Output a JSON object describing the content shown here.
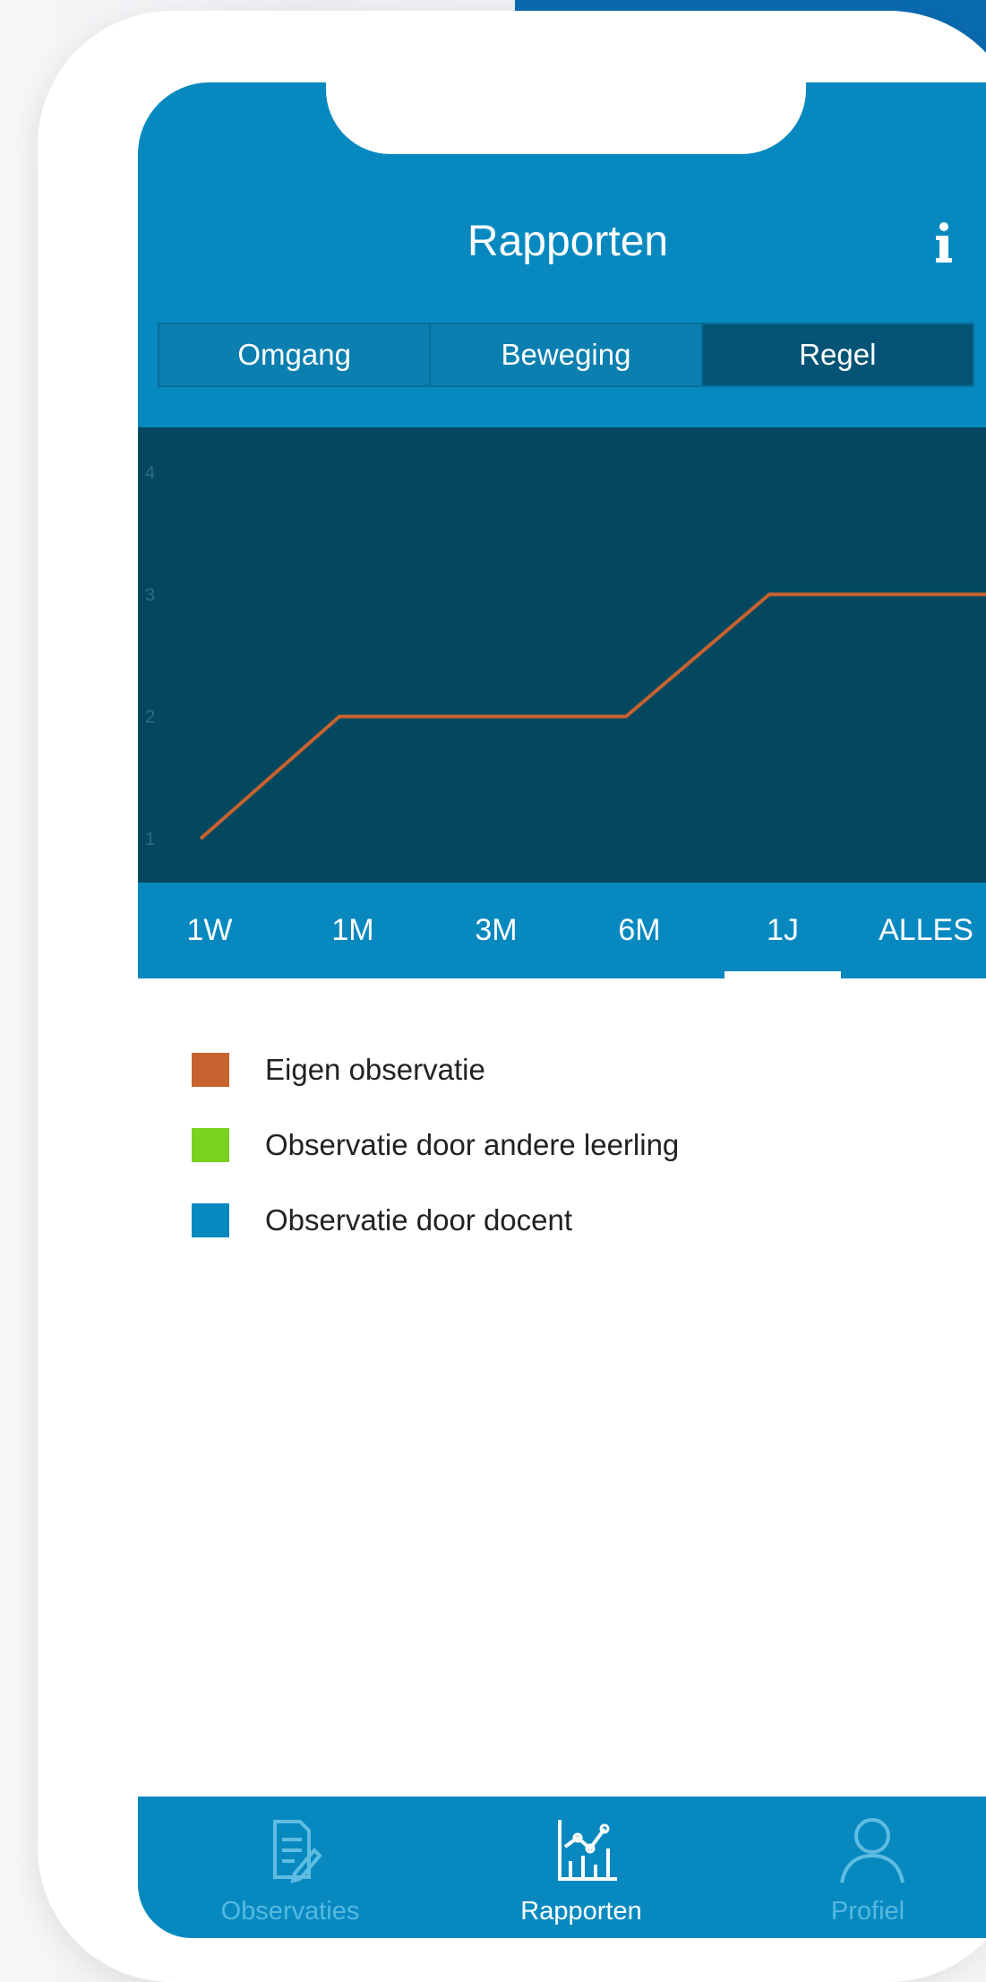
{
  "header": {
    "title": "Rapporten",
    "info_icon": "info-icon"
  },
  "segments": [
    {
      "label": "Omgang",
      "active": false
    },
    {
      "label": "Beweging",
      "active": false
    },
    {
      "label": "Regel",
      "active": true
    }
  ],
  "chart_data": {
    "type": "line",
    "y_ticks": [
      "1",
      "2",
      "3",
      "4"
    ],
    "ylim": [
      1,
      4
    ],
    "grid": false,
    "series": [
      {
        "name": "Eigen observatie",
        "color": "#c8622f",
        "values": [
          1,
          2,
          2,
          3,
          3
        ]
      }
    ]
  },
  "ranges": [
    {
      "label": "1W",
      "active": false
    },
    {
      "label": "1M",
      "active": false
    },
    {
      "label": "3M",
      "active": false
    },
    {
      "label": "6M",
      "active": false
    },
    {
      "label": "1J",
      "active": true
    },
    {
      "label": "ALLES",
      "active": false
    }
  ],
  "legend": [
    {
      "label": "Eigen observatie",
      "color": "#c8622f"
    },
    {
      "label": "Observatie door andere leerling",
      "color": "#7bd11f"
    },
    {
      "label": "Observatie door docent",
      "color": "#0789c0"
    }
  ],
  "tabbar": [
    {
      "label": "Observaties",
      "icon": "document-edit-icon",
      "active": false
    },
    {
      "label": "Rapporten",
      "icon": "chart-icon",
      "active": true
    },
    {
      "label": "Profiel",
      "icon": "person-icon",
      "active": false
    }
  ],
  "colors": {
    "primary": "#0789c0",
    "chart_background": "#03485f",
    "segment_active": "#055475"
  }
}
